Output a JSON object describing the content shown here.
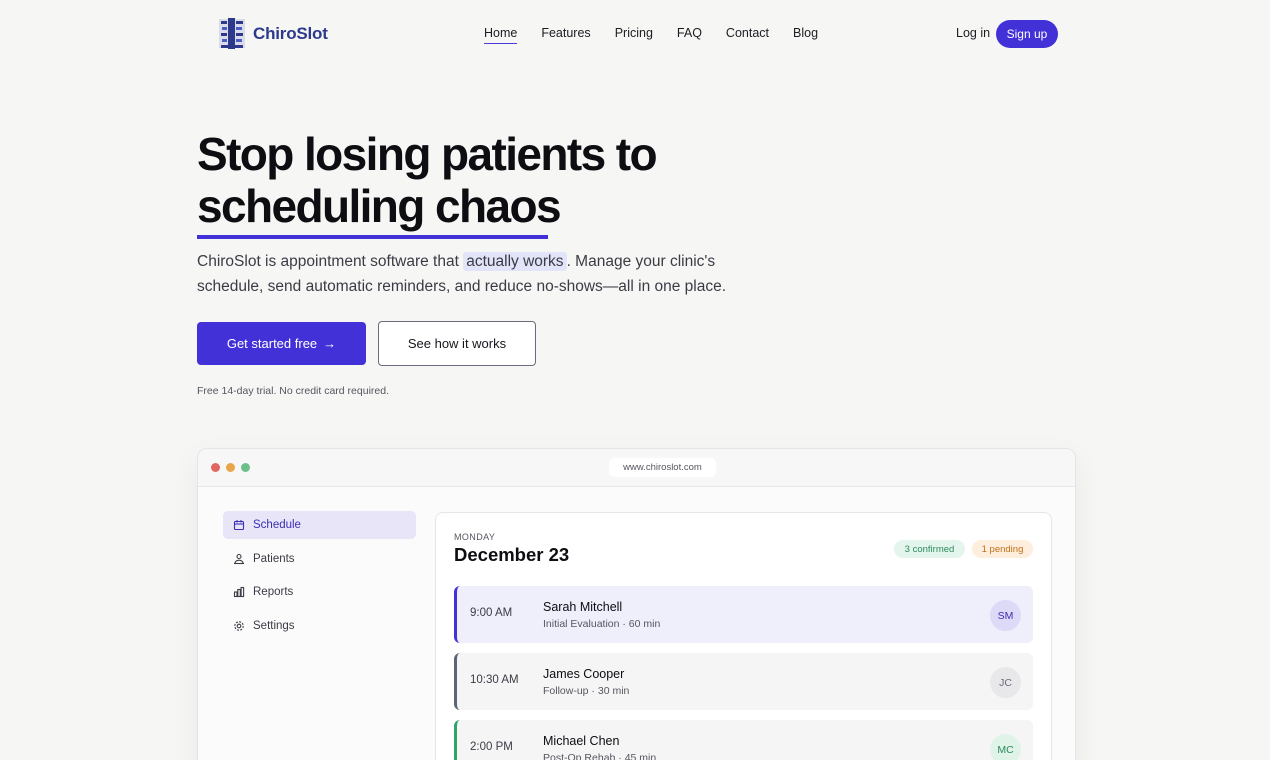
{
  "brand": {
    "name": "ChiroSlot"
  },
  "nav": {
    "links": [
      {
        "label": "Home",
        "active": true
      },
      {
        "label": "Features"
      },
      {
        "label": "Pricing"
      },
      {
        "label": "FAQ"
      },
      {
        "label": "Contact"
      },
      {
        "label": "Blog"
      }
    ],
    "login": "Log in",
    "signup": "Sign up"
  },
  "hero": {
    "title_line1": "Stop losing patients to",
    "title_line2": "scheduling chaos",
    "subtitle_pre": "ChiroSlot is appointment software that ",
    "subtitle_highlight": "actually works",
    "subtitle_post": ". Manage your clinic's schedule, send automatic reminders, and reduce no-shows—all in one place.",
    "cta_primary": "Get started free",
    "cta_primary_arrow": "→",
    "cta_secondary": "See how it works",
    "trial_note": "Free 14-day trial. No credit card required."
  },
  "mockup": {
    "url": "www.chiroslot.com",
    "sidebar": [
      {
        "label": "Schedule",
        "icon": "calendar-icon",
        "active": true
      },
      {
        "label": "Patients",
        "icon": "users-icon"
      },
      {
        "label": "Reports",
        "icon": "bar-chart-icon"
      },
      {
        "label": "Settings",
        "icon": "gear-icon"
      }
    ],
    "day_label": "MONDAY",
    "date": "December 23",
    "badges": {
      "confirmed": "3 confirmed",
      "pending": "1 pending"
    },
    "appointments": [
      {
        "time": "9:00 AM",
        "name": "Sarah Mitchell",
        "desc": "Initial Evaluation · 60 min",
        "initials": "SM"
      },
      {
        "time": "10:30 AM",
        "name": "James Cooper",
        "desc": "Follow-up · 30 min",
        "initials": "JC"
      },
      {
        "time": "2:00 PM",
        "name": "Michael Chen",
        "desc": "Post-Op Rehab · 45 min",
        "initials": "MC"
      }
    ]
  },
  "colors": {
    "accent": "#4331d8",
    "background": "#f6f6f5",
    "confirmed": "#2d8a5d",
    "pending": "#c27016"
  }
}
